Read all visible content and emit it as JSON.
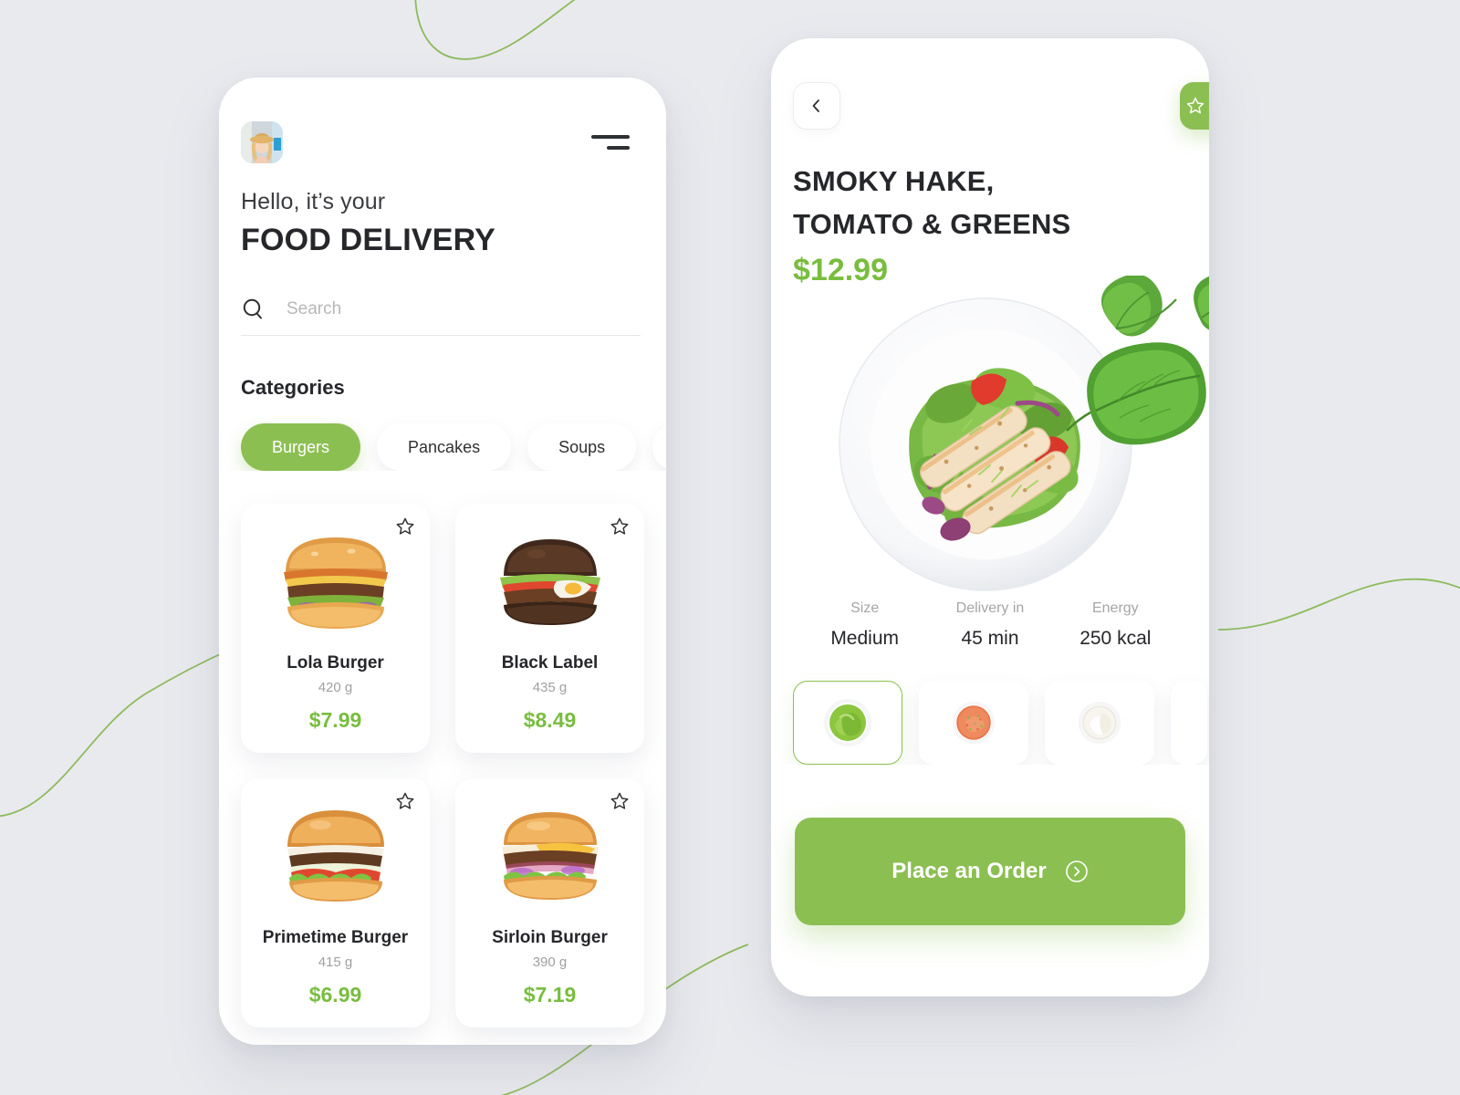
{
  "theme": {
    "accent_green": "#8CBF52",
    "price_green": "#79BD3F",
    "page_background": "#E9EAEE",
    "card_white": "#FFFFFF",
    "text_dark": "#26272B",
    "text_muted": "#A0A0A3"
  },
  "home_screen": {
    "avatar_icon": "user-avatar-photo",
    "menu_icon": "hamburger-menu-icon",
    "greeting_line": "Hello, it’s your",
    "app_title": "FOOD DELIVERY",
    "search": {
      "icon": "search-icon",
      "placeholder": "Search",
      "value": ""
    },
    "categories_heading": "Categories",
    "categories": [
      {
        "label": "Burgers",
        "active": true
      },
      {
        "label": "Pancakes",
        "active": false
      },
      {
        "label": "Soups",
        "active": false
      },
      {
        "label": "",
        "active": false
      }
    ],
    "products": [
      {
        "name": "Lola Burger",
        "weight": "420 g",
        "price": "$7.99",
        "image_icon": "burger-classic-cheese-icon",
        "fav_icon": "star-outline-icon"
      },
      {
        "name": "Black Label",
        "weight": "435 g",
        "price": "$8.49",
        "image_icon": "burger-black-bun-icon",
        "fav_icon": "star-outline-icon"
      },
      {
        "name": "Primetime Burger",
        "weight": "415 g",
        "price": "$6.99",
        "image_icon": "burger-lettuce-tomato-icon",
        "fav_icon": "star-outline-icon"
      },
      {
        "name": "Sirloin Burger",
        "weight": "390 g",
        "price": "$7.19",
        "image_icon": "burger-sirloin-onion-icon",
        "fav_icon": "star-outline-icon"
      }
    ]
  },
  "detail_screen": {
    "back_icon": "chevron-left-icon",
    "favorite_icon": "star-outline-icon",
    "dish_title_line1": "SMOKY HAKE,",
    "dish_title_line2": "TOMATO & GREENS",
    "dish_price": "$12.99",
    "dish_image_icon": "salad-plate-photo",
    "decor_icon": "basil-leaves-icon",
    "meta": [
      {
        "label": "Size",
        "value": "Medium"
      },
      {
        "label": "Delivery in",
        "value": "45 min"
      },
      {
        "label": "Energy",
        "value": "250 kcal"
      }
    ],
    "sauces": [
      {
        "icon": "sauce-green-pesto-icon",
        "selected": true
      },
      {
        "icon": "sauce-red-salsa-icon",
        "selected": false
      },
      {
        "icon": "sauce-white-mayo-icon",
        "selected": false
      },
      {
        "icon": "sauce-partial-icon",
        "selected": false
      }
    ],
    "order_button_label": "Place an Order",
    "order_button_icon": "arrow-right-circle-icon"
  }
}
